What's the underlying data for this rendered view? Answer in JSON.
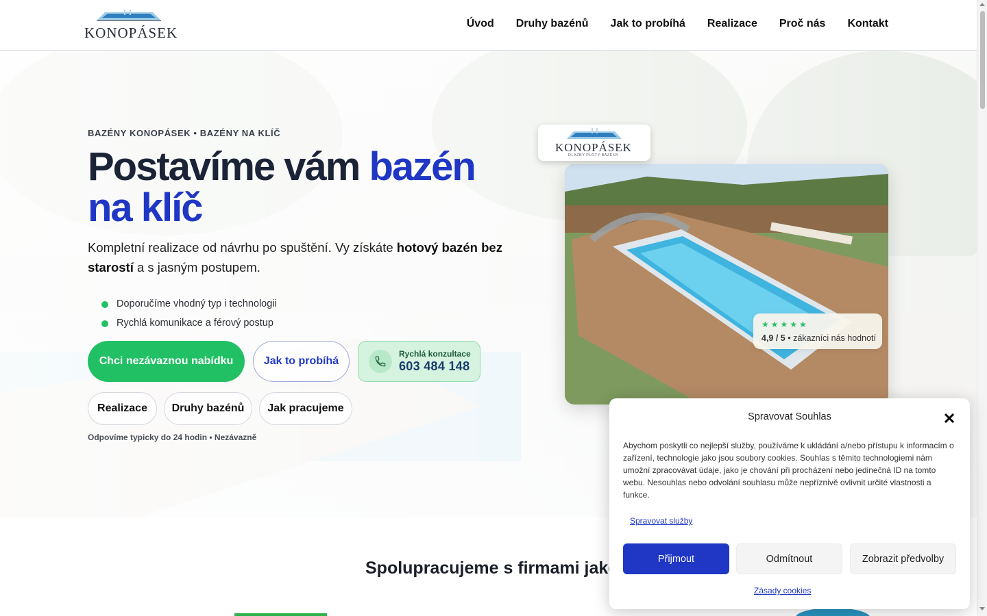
{
  "header": {
    "logo_text": "KONOPÁSEK",
    "nav": [
      "Úvod",
      "Druhy bazénů",
      "Jak to probíhá",
      "Realizace",
      "Proč nás",
      "Kontakt"
    ]
  },
  "hero": {
    "eyebrow": "BAZÉNY KONOPÁSEK • BAZÉNY NA KLÍČ",
    "title_part1": "Postavíme vám ",
    "title_accent": "bazén na klíč",
    "lead_part1": "Kompletní realizace od návrhu po spuštění. Vy získáte ",
    "lead_bold": "hotový bazén bez starostí",
    "lead_part2": " a s jasným postupem.",
    "bullets": [
      "Doporučíme vhodný typ i technologii",
      "Rychlá komunikace a férový postup"
    ],
    "cta_primary": "Chci nezávaznou nabídku",
    "cta_secondary": "Jak to probíhá",
    "phone_label": "Rychlá konzultace",
    "phone_number": "603 484 148",
    "pills": [
      "Realizace",
      "Druhy bazénů",
      "Jak pracujeme"
    ],
    "note": "Odpovíme typicky do 24 hodin • Nezávazně"
  },
  "card": {
    "logo_text": "KONOPÁSEK",
    "logo_subtitle": "DLAŽBY-PLOTY-BAZÉNY",
    "stars": "★★★★★",
    "rating_value": "4,9 / 5",
    "rating_text": " • zákazníci nás hodnotí"
  },
  "partners": {
    "title": "Spolupracujeme s firmami jako"
  },
  "cookie": {
    "title": "Spravovat Souhlas",
    "body": "Abychom poskytli co nejlepší služby, používáme k ukládání a/nebo přístupu k informacím o zařízení, technologie jako jsou soubory cookies. Souhlas s těmito technologiemi nám umožní zpracovávat údaje, jako je chování při procházení nebo jedinečná ID na tomto webu. Nesouhlas nebo odvolání souhlasu může nepříznivě ovlivnit určité vlastnosti a funkce.",
    "manage_link": "Spravovat služby",
    "accept": "Přijmout",
    "deny": "Odmítnout",
    "prefs": "Zobrazit předvolby",
    "policy_link": "Zásady cookies"
  },
  "colors": {
    "accent_blue": "#1f37c4",
    "accent_green": "#22c064",
    "title_dark": "#1b2437"
  }
}
